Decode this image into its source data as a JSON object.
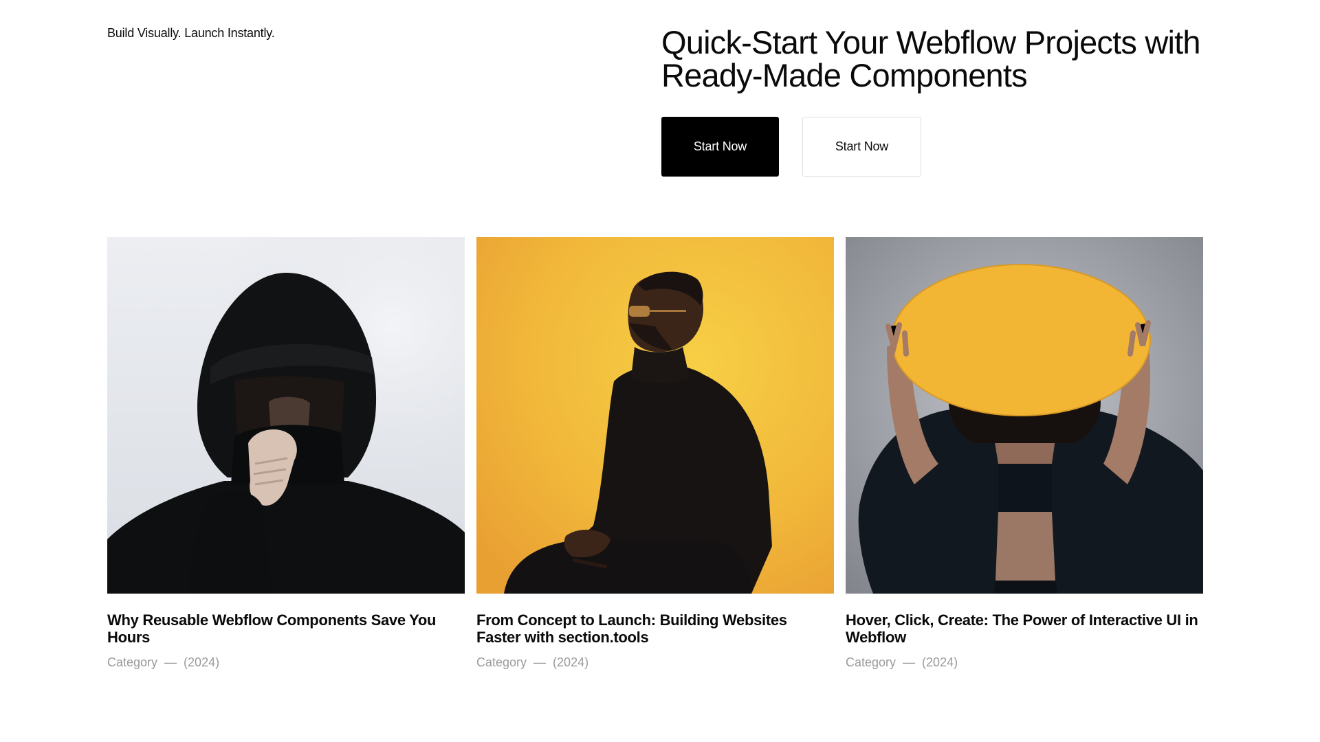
{
  "header": {
    "tagline": "Build Visually. Launch Instantly.",
    "title": "Quick-Start Your Webflow Projects with Ready-Made Components",
    "primary_button": "Start Now",
    "secondary_button": "Start Now"
  },
  "cards": [
    {
      "title": "Why Reusable Webflow Components Save You Hours",
      "category": "Category",
      "separator": "—",
      "year": "(2024)",
      "image": "person-in-black-hood-icon"
    },
    {
      "title": "From Concept to Launch: Building Websites Faster with section.tools",
      "category": "Category",
      "separator": "—",
      "year": "(2024)",
      "image": "man-on-yellow-background-icon"
    },
    {
      "title": "Hover, Click, Create: The Power of Interactive UI in Webflow",
      "category": "Category",
      "separator": "—",
      "year": "(2024)",
      "image": "woman-holding-yellow-oval-icon"
    }
  ],
  "colors": {
    "background": "#ffffff",
    "primary_button": "#000000",
    "meta_text": "#9a9a9a",
    "accent_yellow": "#f2b534"
  }
}
